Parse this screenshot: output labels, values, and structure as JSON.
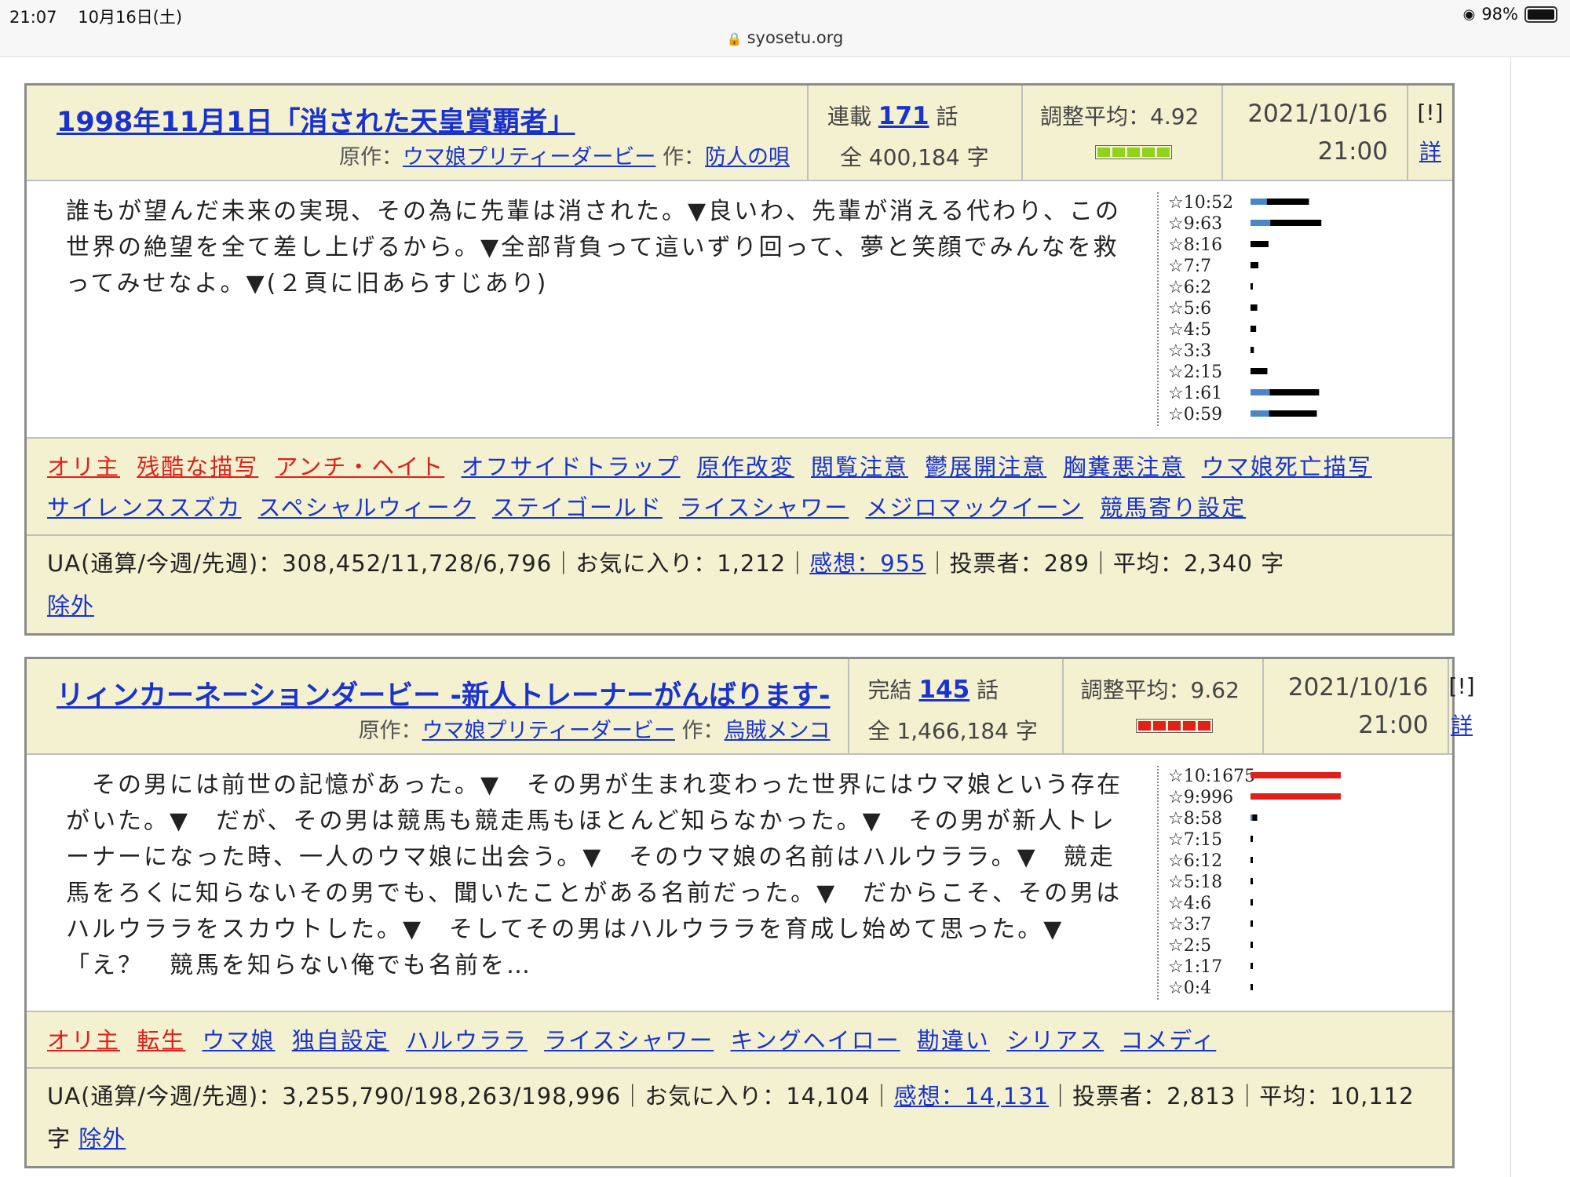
{
  "status_bar": {
    "time": "21:07",
    "date": "10月16日(土)",
    "battery": "98%",
    "url": "syosetu.org",
    "battery_level": 0.98
  },
  "novels": [
    {
      "title": "1998年11月1日「消された天皇賞覇者」",
      "genre_label": "原作：",
      "genre": "ウマ娘プリティーダービー",
      "author_label": "作：",
      "author": "防人の唄",
      "status_label": "連載",
      "episodes": "171",
      "episodes_unit": "話",
      "chars": "全 400,184 字",
      "score": "調整平均：4.92",
      "gauge_color": "#8fd418",
      "date": "2021/10/16",
      "time": "21:00",
      "report": "[!]",
      "detail": "詳",
      "synopsis": "誰もが望んだ未来の実現、その為に先輩は消された。▼良いわ、先輩が消える代わり、この世界の絶望を全て差し上げるから。▼全部背負って這いずり回って、夢と笑顔でみんなを救ってみせなよ。▼(２頁に旧あらすじあり)",
      "ratings": [
        {
          "label": "☆10:52",
          "count": 52
        },
        {
          "label": "☆9:63",
          "count": 63
        },
        {
          "label": "☆8:16",
          "count": 16
        },
        {
          "label": "☆7:7",
          "count": 7
        },
        {
          "label": "☆6:2",
          "count": 2
        },
        {
          "label": "☆5:6",
          "count": 6
        },
        {
          "label": "☆4:5",
          "count": 5
        },
        {
          "label": "☆3:3",
          "count": 3
        },
        {
          "label": "☆2:15",
          "count": 15
        },
        {
          "label": "☆1:61",
          "count": 61
        },
        {
          "label": "☆0:59",
          "count": 59
        }
      ],
      "tags": [
        {
          "text": "オリ主",
          "color": "red"
        },
        {
          "text": "残酷な描写",
          "color": "red"
        },
        {
          "text": "アンチ・ヘイト",
          "color": "red"
        },
        {
          "text": "オフサイドトラップ",
          "color": "blue"
        },
        {
          "text": "原作改変",
          "color": "blue"
        },
        {
          "text": "閲覧注意",
          "color": "blue"
        },
        {
          "text": "鬱展開注意",
          "color": "blue"
        },
        {
          "text": "胸糞悪注意",
          "color": "blue"
        },
        {
          "text": "ウマ娘死亡描写",
          "color": "blue"
        },
        {
          "text": "サイレンススズカ",
          "color": "blue"
        },
        {
          "text": "スペシャルウィーク",
          "color": "blue"
        },
        {
          "text": "ステイゴールド",
          "color": "blue"
        },
        {
          "text": "ライスシャワー",
          "color": "blue"
        },
        {
          "text": "メジロマックイーン",
          "color": "blue"
        },
        {
          "text": "競馬寄り設定",
          "color": "blue"
        }
      ],
      "stats_before": "UA(通算/今週/先週)：308,452/11,728/6,796｜お気に入り：1,212｜",
      "impressions": "感想：955",
      "stats_after": "｜投票者：289｜平均：2,340 字",
      "exclude": "除外"
    },
    {
      "title": "リィンカーネーションダービー -新人トレーナーがんばります-",
      "genre_label": "原作：",
      "genre": "ウマ娘プリティーダービー",
      "author_label": "作：",
      "author": "烏賊メンコ",
      "status_label": "完結",
      "episodes": "145",
      "episodes_unit": "話",
      "chars": "全 1,466,184 字",
      "score": "調整平均：9.62",
      "gauge_color": "#e0201b",
      "date": "2021/10/16",
      "time": "21:00",
      "report": "[!]",
      "detail": "詳",
      "synopsis": "　その男には前世の記憶があった。▼　その男が生まれ変わった世界にはウマ娘という存在がいた。▼　だが、その男は競馬も競走馬もほとんど知らなかった。▼　その男が新人トレーナーになった時、一人のウマ娘に出会う。▼　そのウマ娘の名前はハルウララ。▼　競走馬をろくに知らないその男でも、聞いたことがある名前だった。▼　だからこそ、その男はハルウララをスカウトした。▼　そしてその男はハルウララを育成し始めて思った。▼「え？　競馬を知らない俺でも名前を…",
      "ratings": [
        {
          "label": "☆10:1675",
          "count": 1675
        },
        {
          "label": "☆9:996",
          "count": 996
        },
        {
          "label": "☆8:58",
          "count": 58
        },
        {
          "label": "☆7:15",
          "count": 15
        },
        {
          "label": "☆6:12",
          "count": 12
        },
        {
          "label": "☆5:18",
          "count": 18
        },
        {
          "label": "☆4:6",
          "count": 6
        },
        {
          "label": "☆3:7",
          "count": 7
        },
        {
          "label": "☆2:5",
          "count": 5
        },
        {
          "label": "☆1:17",
          "count": 17
        },
        {
          "label": "☆0:4",
          "count": 4
        }
      ],
      "tags": [
        {
          "text": "オリ主",
          "color": "red"
        },
        {
          "text": "転生",
          "color": "red"
        },
        {
          "text": "ウマ娘",
          "color": "blue"
        },
        {
          "text": "独自設定",
          "color": "blue"
        },
        {
          "text": "ハルウララ",
          "color": "blue"
        },
        {
          "text": "ライスシャワー",
          "color": "blue"
        },
        {
          "text": "キングヘイロー",
          "color": "blue"
        },
        {
          "text": "勘違い",
          "color": "blue"
        },
        {
          "text": "シリアス",
          "color": "blue"
        },
        {
          "text": "コメディ",
          "color": "blue"
        }
      ],
      "stats_before": "UA(通算/今週/先週)：3,255,790/198,263/198,996｜お気に入り：14,104｜",
      "impressions": "感想：14,131",
      "stats_after": "｜投票者：2,813｜平均：10,112 字",
      "exclude": "除外"
    }
  ]
}
